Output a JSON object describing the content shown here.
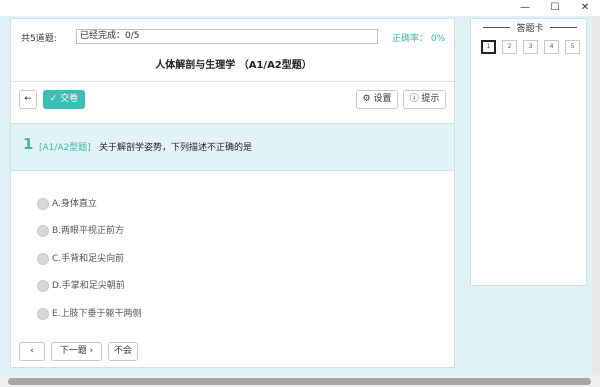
{
  "window": {
    "minimize": "—",
    "maximize": "☐",
    "close": "✕"
  },
  "header": {
    "total_label": "共5道题:",
    "progress_value": "已经完成：0/5",
    "accuracy": "正确率：  0%",
    "exam_title": "人体解剖与生理学 （A1/A2型题）"
  },
  "toolbar": {
    "back_icon": "←",
    "submit_label": "✓ 交卷",
    "settings_label": "⚙ 设置",
    "hint_label": "ⓘ 提示"
  },
  "question": {
    "number": "1",
    "type": "[A1/A2型题]",
    "text": "关于解剖学姿势，下列描述不正确的是",
    "options": [
      "A.身体直立",
      "B.两眼平视正前方",
      "C.手背和足尖向前",
      "D.手掌和足尖朝前",
      "E.上肢下垂于躯干两侧"
    ]
  },
  "nav": {
    "prev_label": "‹",
    "next_label": "下一题 ›",
    "skip_label": "不会"
  },
  "answer_card": {
    "title": "答题卡",
    "cells": [
      "1",
      "2",
      "3",
      "4",
      "5"
    ],
    "current": 1
  }
}
